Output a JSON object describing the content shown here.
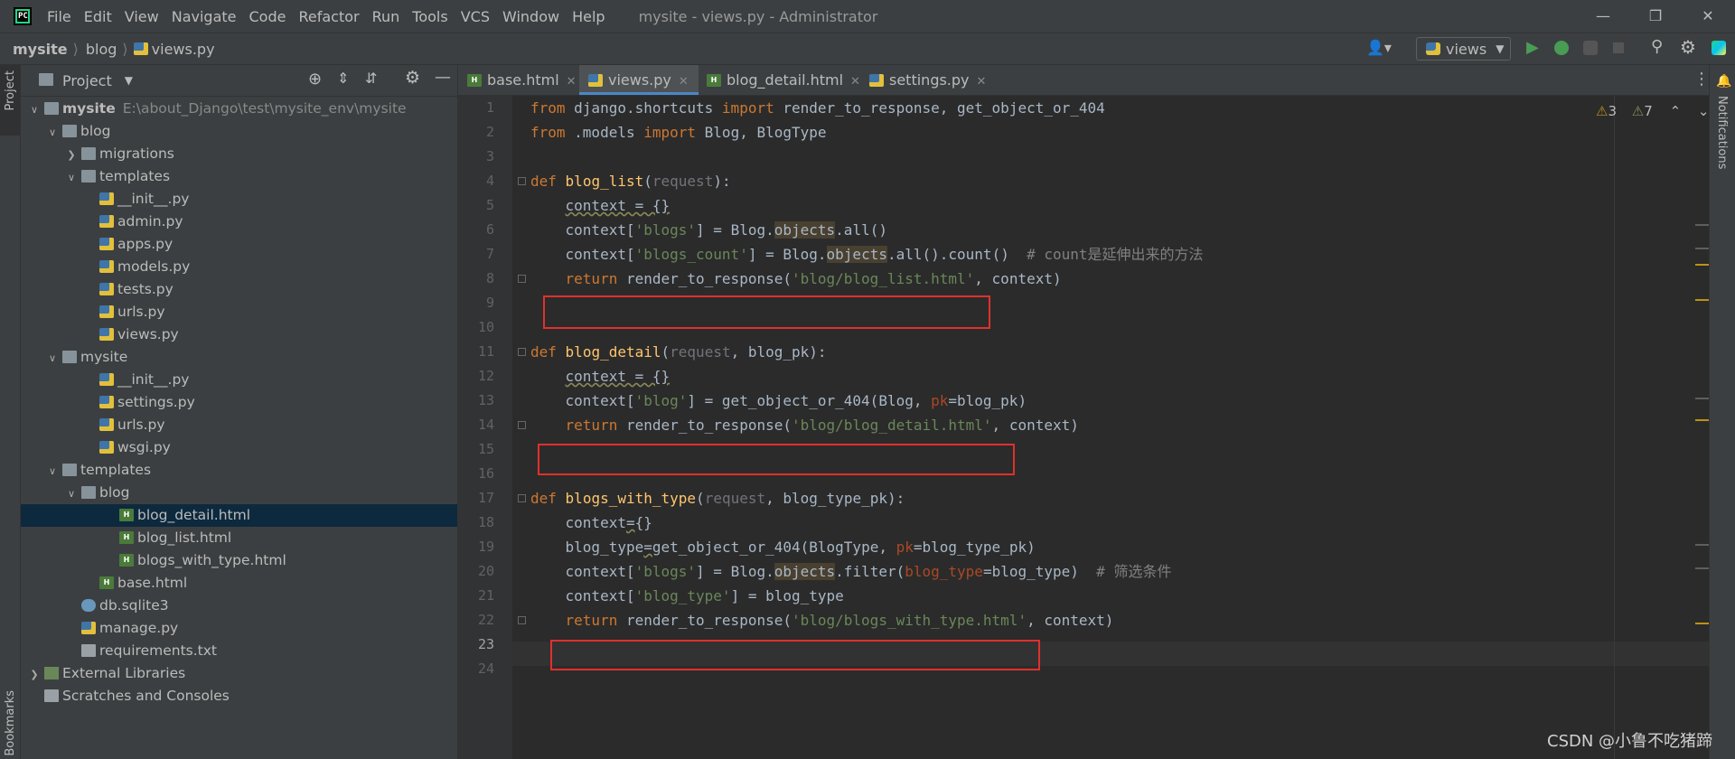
{
  "titlebar": {
    "menu": [
      "File",
      "Edit",
      "View",
      "Navigate",
      "Code",
      "Refactor",
      "Run",
      "Tools",
      "VCS",
      "Window",
      "Help"
    ],
    "window_title": "mysite - views.py - Administrator",
    "logo_text": "PC"
  },
  "breadcrumb": [
    "mysite",
    "blog",
    "views.py"
  ],
  "run_config": "views",
  "toolbar_icons": [
    "user-icon",
    "run-icon",
    "debug-icon",
    "coverage-icon",
    "stop-icon",
    "search-icon",
    "settings-icon",
    "jetbrains-icon"
  ],
  "left_strip": {
    "project": "Project",
    "bookmarks": "Bookmarks"
  },
  "right_strip": {
    "notifications": "Notifications"
  },
  "project_panel": {
    "title": "Project",
    "tree": [
      {
        "label": "mysite",
        "path": "E:\\about_Django\\test\\mysite_env\\mysite",
        "icon": "folder",
        "depth": 0,
        "arrow": "down",
        "bold": true
      },
      {
        "label": "blog",
        "icon": "folder",
        "depth": 1,
        "arrow": "down"
      },
      {
        "label": "migrations",
        "icon": "folder",
        "depth": 2,
        "arrow": "right"
      },
      {
        "label": "templates",
        "icon": "folder",
        "depth": 2,
        "arrow": "down"
      },
      {
        "label": "__init__.py",
        "icon": "py",
        "depth": 3
      },
      {
        "label": "admin.py",
        "icon": "py",
        "depth": 3
      },
      {
        "label": "apps.py",
        "icon": "py",
        "depth": 3
      },
      {
        "label": "models.py",
        "icon": "py",
        "depth": 3
      },
      {
        "label": "tests.py",
        "icon": "py",
        "depth": 3
      },
      {
        "label": "urls.py",
        "icon": "py",
        "depth": 3
      },
      {
        "label": "views.py",
        "icon": "py",
        "depth": 3
      },
      {
        "label": "mysite",
        "icon": "folder",
        "depth": 1,
        "arrow": "down"
      },
      {
        "label": "__init__.py",
        "icon": "py",
        "depth": 3
      },
      {
        "label": "settings.py",
        "icon": "py",
        "depth": 3
      },
      {
        "label": "urls.py",
        "icon": "py",
        "depth": 3
      },
      {
        "label": "wsgi.py",
        "icon": "py",
        "depth": 3
      },
      {
        "label": "templates",
        "icon": "folder",
        "depth": 1,
        "arrow": "down"
      },
      {
        "label": "blog",
        "icon": "folder",
        "depth": 2,
        "arrow": "down"
      },
      {
        "label": "blog_detail.html",
        "icon": "html",
        "depth": 4,
        "selected": true
      },
      {
        "label": "blog_list.html",
        "icon": "html",
        "depth": 4
      },
      {
        "label": "blogs_with_type.html",
        "icon": "html",
        "depth": 4
      },
      {
        "label": "base.html",
        "icon": "html",
        "depth": 3
      },
      {
        "label": "db.sqlite3",
        "icon": "db",
        "depth": 2
      },
      {
        "label": "manage.py",
        "icon": "py",
        "depth": 2
      },
      {
        "label": "requirements.txt",
        "icon": "txt",
        "depth": 2
      },
      {
        "label": "External Libraries",
        "icon": "lib",
        "depth": 0,
        "arrow": "right"
      },
      {
        "label": "Scratches and Consoles",
        "icon": "scratch",
        "depth": 0
      }
    ]
  },
  "tabs": [
    {
      "label": "base.html",
      "icon": "html",
      "active": false
    },
    {
      "label": "views.py",
      "icon": "py",
      "active": true
    },
    {
      "label": "blog_detail.html",
      "icon": "html",
      "active": false
    },
    {
      "label": "settings.py",
      "icon": "py",
      "active": false
    }
  ],
  "inspections": {
    "warnings": "3",
    "weak_warnings": "7"
  },
  "editor": {
    "current_line": 23,
    "line_numbers": [
      "1",
      "2",
      "3",
      "4",
      "5",
      "6",
      "7",
      "8",
      "9",
      "10",
      "11",
      "12",
      "13",
      "14",
      "15",
      "16",
      "17",
      "18",
      "19",
      "20",
      "21",
      "22",
      "23",
      "24"
    ],
    "highlighted_lines": [
      9,
      15,
      23
    ]
  },
  "watermark": "CSDN @小鲁不吃猪蹄"
}
